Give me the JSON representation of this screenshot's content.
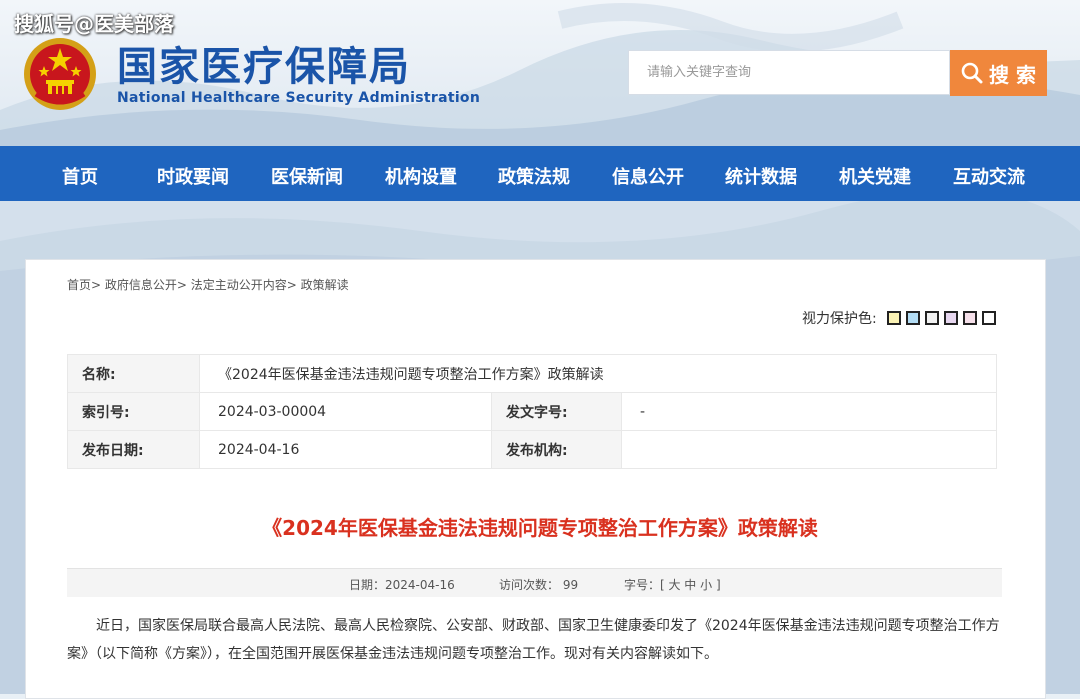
{
  "watermark": "搜狐号@医美部落",
  "header": {
    "title_cn": "国家医疗保障局",
    "title_en": "National Healthcare Security Administration",
    "search_placeholder": "请输入关键字查询",
    "search_label": "搜 索"
  },
  "nav": {
    "items": [
      "首页",
      "时政要闻",
      "医保新闻",
      "机构设置",
      "政策法规",
      "信息公开",
      "统计数据",
      "机关党建",
      "互动交流"
    ]
  },
  "breadcrumb": [
    "首页",
    "政府信息公开",
    "法定主动公开内容",
    "政策解读"
  ],
  "vision": {
    "label": "视力保护色:",
    "swatches": [
      "#fbf3b5",
      "#b3ddf5",
      "#f2f2f2",
      "#e7d7f0",
      "#f6e0ea",
      "#ffffff"
    ]
  },
  "meta": {
    "name_label": "名称:",
    "name_value": "《2024年医保基金违法违规问题专项整治工作方案》政策解读",
    "index_label": "索引号:",
    "index_value": "2024-03-00004",
    "docno_label": "发文字号:",
    "docno_value": "-",
    "date_label": "发布日期:",
    "date_value": "2024-04-16",
    "org_label": "发布机构:",
    "org_value": ""
  },
  "article": {
    "title": "《2024年医保基金违法违规问题专项整治工作方案》政策解读",
    "date": "日期：2024-04-16",
    "visits": "访问次数：  99",
    "font_size": "字号：[ 大 中 小 ]",
    "body": "近日，国家医保局联合最高人民法院、最高人民检察院、公安部、财政部、国家卫生健康委印发了《2024年医保基金违法违规问题专项整治工作方案》（以下简称《方案》），在全国范围开展医保基金违法违规问题专项整治工作。现对有关内容解读如下。"
  },
  "colors": {
    "brand_blue": "#1f65bf",
    "title_red": "#d9311f",
    "search_orange": "#f0873c"
  }
}
